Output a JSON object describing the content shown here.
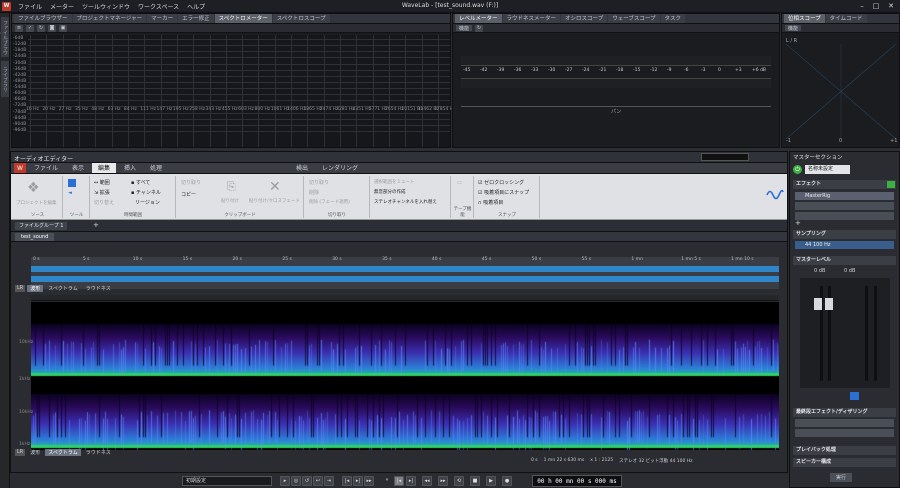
{
  "app": {
    "title": "WaveLab - [test_sound.wav (F:)]",
    "menu": [
      "ファイル",
      "メーター",
      "ツールウィンドウ",
      "ワークスペース",
      "ヘルプ"
    ]
  },
  "left_strip": [
    "ファイルブラウザー",
    "ライブラリ"
  ],
  "top_left_panel": {
    "tabs": [
      "ファイルブラウザー",
      "プロジェクトマネージャー",
      "マーカー",
      "エラー修正",
      "スペクトロメーター",
      "スペクトロスコープ"
    ],
    "active": 4,
    "y_labels": [
      "-6dB",
      "-12dB",
      "-18dB",
      "-24dB",
      "-30dB",
      "-36dB",
      "-42dB",
      "-48dB",
      "-54dB",
      "-60dB",
      "-66dB",
      "-72dB",
      "-78dB",
      "-84dB",
      "-90dB",
      "-96dB"
    ],
    "x_labels": [
      "16 Hz",
      "20 Hz",
      "27 Hz",
      "35 Hz",
      "48 Hz",
      "63 Hz",
      "84 Hz",
      "111 Hz",
      "147 Hz",
      "195 Hz",
      "258 Hz",
      "343 Hz",
      "455 Hz",
      "603 Hz",
      "800 Hz",
      "1061 Hz",
      "1406 Hz",
      "1865 Hz",
      "2474 Hz",
      "3281 Hz",
      "4351 Hz",
      "5771 Hz",
      "7654 Hz",
      "10151 Hz",
      "13462 Hz",
      "17854 Hz"
    ]
  },
  "level_panel": {
    "tabs": [
      "レベルメーター",
      "ラウドネスメーター",
      "オシロスコープ",
      "ウェーブスコープ",
      "タスク"
    ],
    "active": 0,
    "settings": "機能",
    "scale": [
      "-45",
      "-42",
      "-39",
      "-36",
      "-33",
      "-30",
      "-27",
      "-24",
      "-21",
      "-18",
      "-15",
      "-12",
      "-9",
      "-6",
      "-3",
      "0",
      "+3",
      "+6 dB"
    ],
    "pan_label": "パン"
  },
  "phase_panel": {
    "tabs": [
      "位相スコープ",
      "タイムコード"
    ],
    "active": 0,
    "settings": "機能",
    "label": "L / R",
    "bottom": [
      "-1",
      "0",
      "+1"
    ]
  },
  "editor": {
    "title": "オーディオエディター",
    "ribbon_tabs": [
      "ファイル",
      "表示",
      "編集",
      "挿入",
      "処理",
      "検出",
      "レンダリング"
    ],
    "active_tab": 2,
    "groups": {
      "source": {
        "cap": "ソース",
        "item": "プロジェクトを編集"
      },
      "tool": {
        "cap": "ツール"
      },
      "time_range": {
        "cap": "時間範囲",
        "items": [
          "範囲",
          "拡張",
          "切り替え",
          "すべて",
          "チャンネル",
          "リージョン"
        ]
      },
      "clipboard": {
        "cap": "クリップボード",
        "items": [
          "切り取り",
          "コピー",
          "貼り付け",
          "貼り付け/クロスフェード"
        ]
      },
      "cut": {
        "cap": "切り取り",
        "items": [
          "切り取り",
          "削除",
          "削除 (フェード適用)"
        ]
      },
      "select": {
        "items": [
          "選択範囲をミュート",
          "無音部分の作成",
          "ステレオチャンネルを入れ替え"
        ]
      },
      "tape": {
        "cap": "テープ機能"
      },
      "snap": {
        "cap": "スナップ",
        "items": [
          "ゼロクロッシング",
          "吸着項目にスナップ",
          "吸着項目"
        ]
      }
    },
    "file_group": "ファイルグループ 1",
    "file_tab": "test_sound",
    "overview_ticks": [
      "0 s",
      "5 s",
      "10 s",
      "15 s",
      "20 s",
      "25 s",
      "30 s",
      "35 s",
      "40 s",
      "45 s",
      "50 s",
      "55 s",
      "1 mn",
      "1 mn 5 s",
      "1 mn 10 s"
    ],
    "view_tabs_top": [
      "LR",
      "波形",
      "スペクトラム",
      "ラウドネス"
    ],
    "view_tabs_bottom": [
      "LR",
      "波形",
      "スペクトラム",
      "ラウドネス"
    ],
    "status": {
      "pos": "0 s",
      "sel": "1 mn 22 s 630 ms",
      "zoom": "x 1 : 2125",
      "format": "ステレオ 32 ビット浮動 44 100 Hz"
    },
    "spec_labels": [
      "L",
      "R"
    ],
    "freq_labels": [
      "10kHz",
      "1kHz",
      "10kHz",
      "1kHz"
    ]
  },
  "master": {
    "title": "マスターセクション",
    "preset": "名称未設定",
    "effects": "エフェクト",
    "plugin": "MasterRig",
    "resampling": "サンプリング",
    "rate": "44 100 Hz",
    "level": "マスターレベル",
    "db": [
      "0 dB",
      "0 dB"
    ],
    "final": "最終段エフェクト/ディザリング",
    "playback": "プレイバック処理",
    "speaker": "スピーカー構成",
    "render": "実行"
  },
  "transport": {
    "preset": "初期設定",
    "time": "00 h 00 mn 00 s 000 ms"
  },
  "colors": {
    "accent": "#1e90ff",
    "green": "#3cb043",
    "spec_bg": "#0b0520"
  }
}
